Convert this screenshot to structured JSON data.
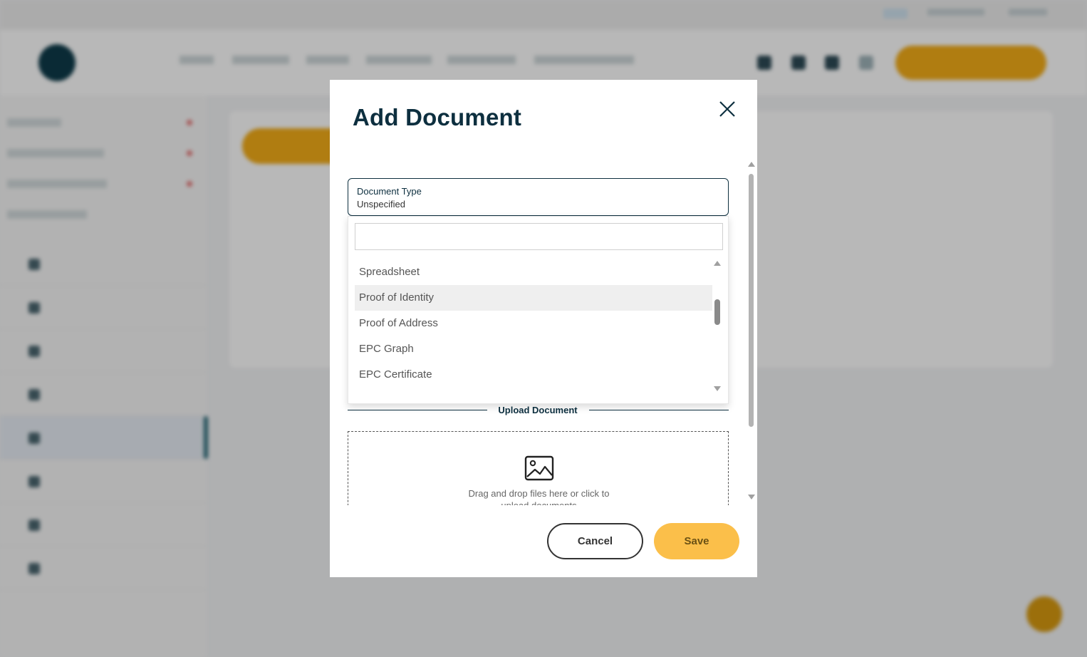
{
  "modal": {
    "title": "Add Document",
    "document_type_label": "Document Type",
    "document_type_value": "Unspecified",
    "search_value": "",
    "options": [
      "Spreadsheet",
      "Proof of Identity",
      "Proof of Address",
      "EPC Graph",
      "EPC Certificate"
    ],
    "highlighted_option": "Proof of Identity",
    "upload_section_label": "Upload Document",
    "upload_hint": "Drag and drop files here or click to upload documents",
    "cancel_label": "Cancel",
    "save_label": "Save"
  },
  "colors": {
    "primary_dark": "#0d2f3f",
    "accent_yellow": "#fbbf4a",
    "highlight_row": "#efefef"
  }
}
